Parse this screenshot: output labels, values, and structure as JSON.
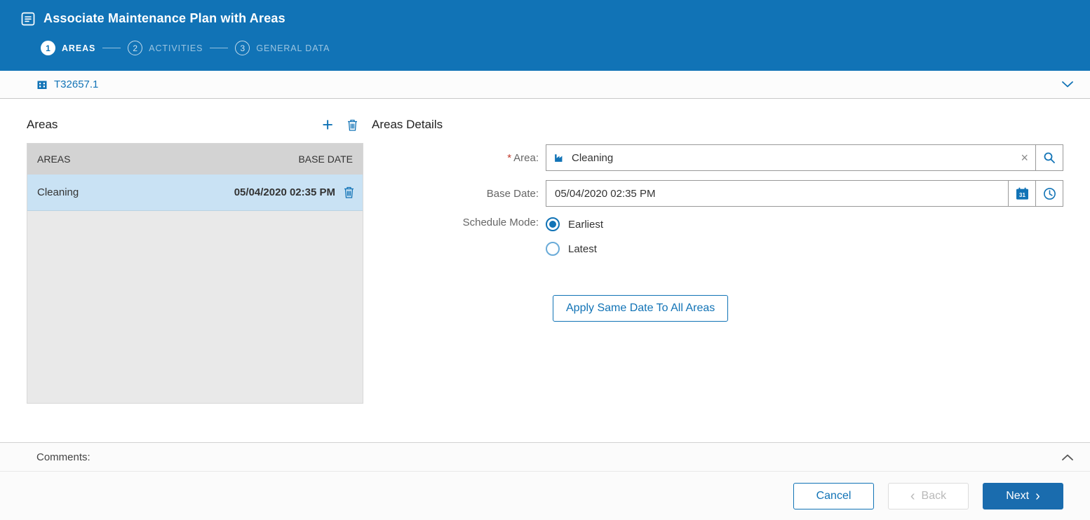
{
  "header": {
    "title": "Associate Maintenance Plan with Areas",
    "steps": [
      {
        "number": "1",
        "label": "AREAS",
        "active": true
      },
      {
        "number": "2",
        "label": "ACTIVITIES",
        "active": false
      },
      {
        "number": "3",
        "label": "GENERAL DATA",
        "active": false
      }
    ]
  },
  "subheader": {
    "plan_id": "T32657.1"
  },
  "areas_panel": {
    "title": "Areas",
    "columns": [
      "AREAS",
      "BASE DATE"
    ],
    "rows": [
      {
        "area": "Cleaning",
        "base_date": "05/04/2020 02:35 PM",
        "selected": true
      }
    ]
  },
  "details_panel": {
    "title": "Areas Details",
    "required_marker": "*",
    "area_label": "Area:",
    "area_value": "Cleaning",
    "base_date_label": "Base Date:",
    "base_date_value": "05/04/2020 02:35 PM",
    "schedule_mode_label": "Schedule Mode:",
    "schedule_options": [
      {
        "label": "Earliest",
        "selected": true
      },
      {
        "label": "Latest",
        "selected": false
      }
    ],
    "apply_button_label": "Apply Same Date To All Areas"
  },
  "comments": {
    "label": "Comments:"
  },
  "footer": {
    "cancel_label": "Cancel",
    "back_label": "Back",
    "next_label": "Next"
  },
  "icons": {
    "plus": "+",
    "clear": "×",
    "back_chevron": "‹",
    "next_chevron": "›"
  },
  "colors": {
    "primary": "#1173b6",
    "header_background": "#1173b6",
    "selected_row": "#c9e2f4",
    "table_header": "#d3d3d3",
    "table_body_background": "#e9e9e9",
    "next_button": "#1a6cae",
    "required": "#c0392b"
  }
}
